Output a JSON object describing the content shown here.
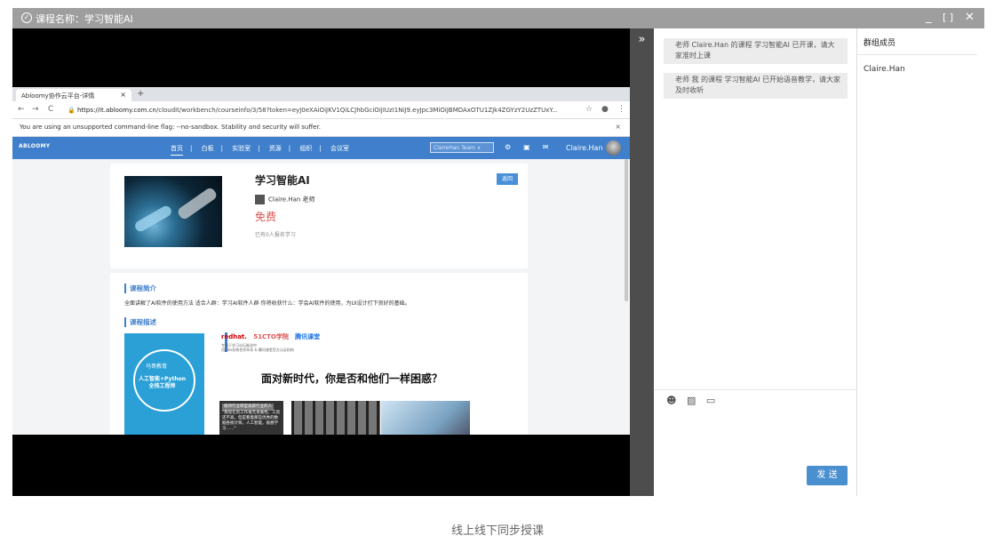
{
  "window": {
    "title": "课程名称：学习智能AI",
    "controls": [
      "_",
      "[ ]",
      "✕"
    ]
  },
  "browser": {
    "tab_title": "Abloomy协作云平台-详情",
    "tab_close": "×",
    "new_tab": "+",
    "nav": [
      "←",
      "→",
      "C"
    ],
    "url_host": "https://it.abloomy.com.cn",
    "url_path": "/cloudit/workbench/courseinfo/3/58?token=eyJ0eXAiOiJKV1QiLCJhbGciOiJIUzI1NiJ9.eyJpc3MiOiJBMDAxOTU1ZJk4ZGYzY2UzZTUxY...",
    "warning": "You are using an unsupported command-line flag: --no-sandbox. Stability and security will suffer.",
    "warning_close": "×"
  },
  "site": {
    "logo": "ABLOOMY",
    "nav": [
      "首页",
      "白板",
      "实验室",
      "资源",
      "组织",
      "会议室"
    ],
    "separators": "|",
    "team_select": "ClaireHan Team",
    "user": "Claire.Han"
  },
  "course": {
    "title": "学习智能AI",
    "back": "返回",
    "teacher": "Claire.Han 老师",
    "price": "免费",
    "enrolled": "已有0人报名学习",
    "intro_heading": "课程简介",
    "intro_text": "全面讲解了AI软件的使用方法 适合人群：学习AI软件人群 你将收获什么：学会AI软件的使用，为UI设计打下良好的基础。",
    "desc_heading": "课程描述",
    "poster_logo": "马哥教育",
    "poster_text": "人工智能+Python\n全栈工程师",
    "brands": [
      "redhat.",
      "51CTO学院",
      "腾讯课堂"
    ],
    "brand_sub": "专属于学习论坛推进中\n用ides机构合作伙伴 & 腾讯课堂官方认证机构",
    "headline": "面对新时代，你是否和他们一样困惑？",
    "box_label": "很待行业转型高薪行业的人",
    "box_text": "\"我现在的工作毫无发展性，工资还不高，但是看着那些优秀的数据各统计师，人工智能，很想学习……\""
  },
  "chat": {
    "messages": [
      "老师 Claire.Han 的课程 学习智能AI 已开课，请大家准时上课",
      "老师 我 的课程 学习智能AI 已开始语音教学，请大家及时收听"
    ],
    "tools": [
      "smile-icon",
      "image-icon",
      "folder-icon"
    ],
    "send": "发 送"
  },
  "sidebar_toggle": "»",
  "members": {
    "title": "群组成员",
    "list": [
      "Claire.Han"
    ]
  },
  "caption": "线上线下同步授课"
}
